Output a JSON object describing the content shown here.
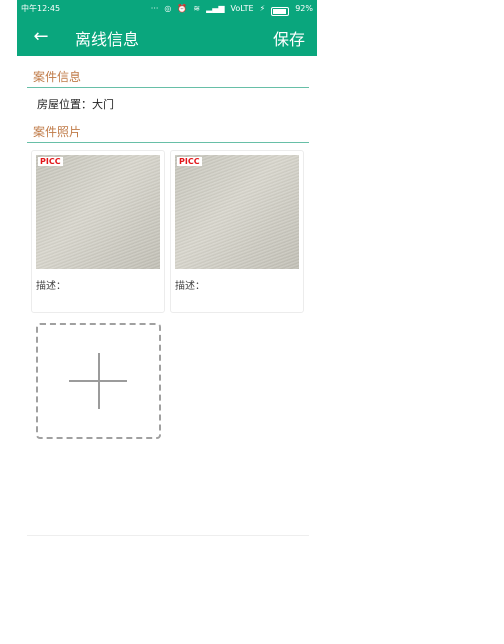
{
  "status_bar": {
    "time": "中午12:45",
    "volte": "VoLTE",
    "battery_percent": "92%",
    "battery_level": 0.92,
    "icons": [
      "more-dots-icon",
      "target-icon",
      "alarm-icon",
      "wifi-icon",
      "signal-icon",
      "charging-icon"
    ]
  },
  "header": {
    "back_icon": "arrow-left-icon",
    "title": "离线信息",
    "save_label": "保存"
  },
  "case_info": {
    "section_title": "案件信息",
    "house_location_label": "房屋位置：",
    "house_location_value": "大门"
  },
  "case_photos": {
    "section_title": "案件照片",
    "photos": [
      {
        "logo": "PICC",
        "desc_label": "描述："
      },
      {
        "logo": "PICC",
        "desc_label": "描述："
      }
    ],
    "add_icon": "plus-icon"
  },
  "colors": {
    "primary": "#0aa67d",
    "section_title": "#c07b48",
    "divider": "#67bfa7"
  }
}
